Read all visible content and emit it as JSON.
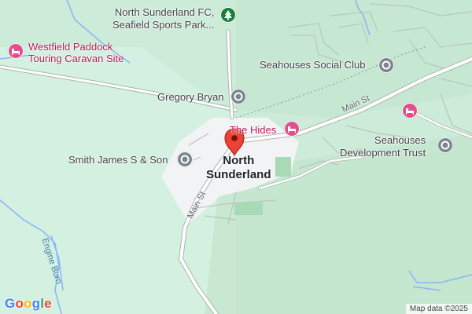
{
  "map": {
    "place": {
      "line1": "North",
      "line2": "Sunderland"
    },
    "pois": {
      "football": {
        "line1": "North Sunderland FC,",
        "line2": "Seafield Sports Park...",
        "icon": "tree-icon"
      },
      "caravan": {
        "line1": "Westfield Paddock",
        "line2": "Touring Caravan Site",
        "icon": "bed-icon"
      },
      "social_club": {
        "name": "Seahouses Social Club",
        "icon": "pin-icon"
      },
      "gregory": {
        "name": "Gregory Bryan",
        "icon": "pin-icon"
      },
      "the_hides": {
        "name": "The Hides",
        "icon": "bed-icon"
      },
      "smith": {
        "name": "Smith James S & Son",
        "icon": "pin-icon"
      },
      "dev_trust": {
        "line1": "Seahouses",
        "line2": "Development Trust",
        "icon": "pin-icon"
      },
      "hotel_right": {
        "icon": "bed-icon"
      }
    },
    "roads": {
      "main_st_east": "Main St",
      "main_st_south": "Main St"
    },
    "water": {
      "engine_burn": "Engine Burn"
    },
    "logo": {
      "g1": "G",
      "o1": "o",
      "o2": "o",
      "g2": "g",
      "l": "l",
      "e": "e"
    },
    "attribution": "Map data ©2025",
    "colors": {
      "land": "#cdebd9",
      "park": "#bfe3c8",
      "built_up": "#f1f3f4",
      "road": "#ffffff",
      "road_outline": "#a9b7ad",
      "water": "#8ab4f8",
      "poi_pink": "#c2185b",
      "poi_grey": "#7b868c",
      "park_icon": "#188038",
      "marker": "#ea4335"
    }
  }
}
